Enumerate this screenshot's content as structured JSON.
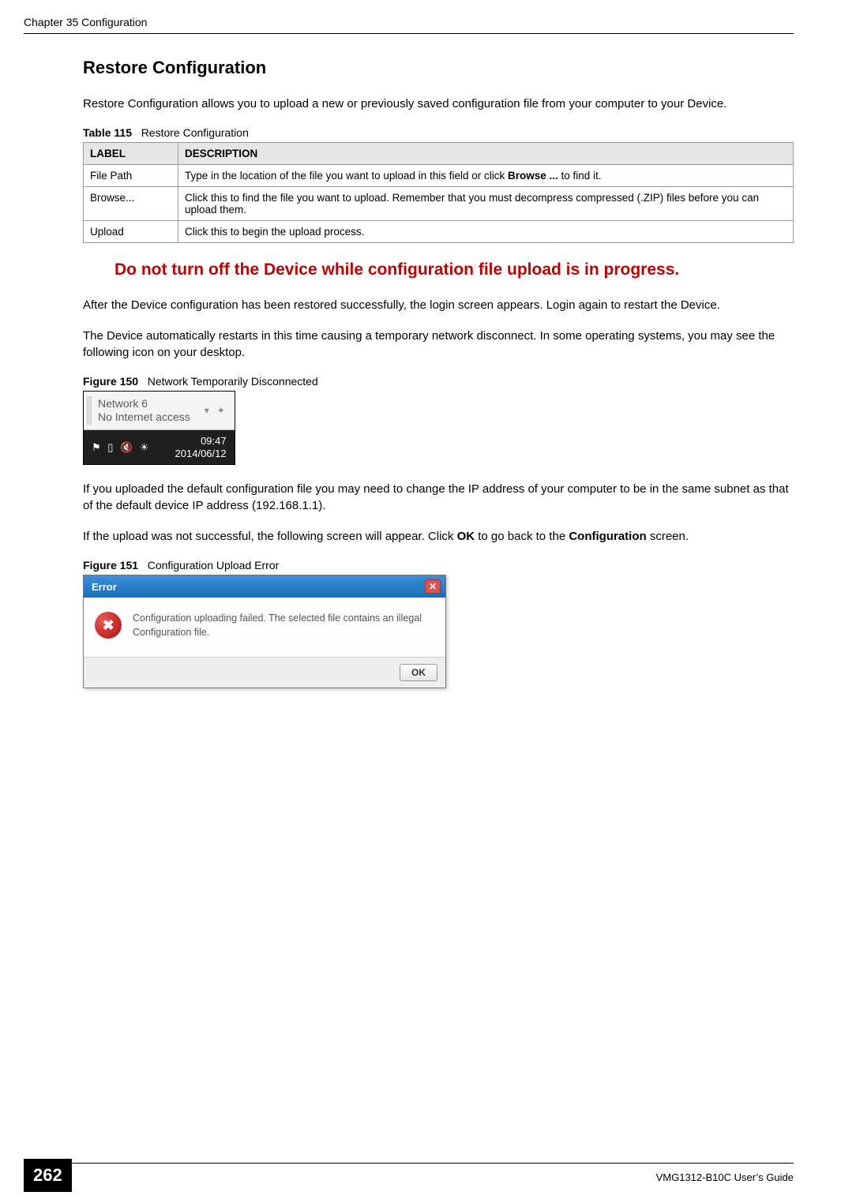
{
  "header": {
    "chapter": "Chapter 35 Configuration"
  },
  "section": {
    "title": "Restore Configuration",
    "intro": "Restore Configuration allows you to upload a new or previously saved configuration file from your computer to your Device."
  },
  "table115": {
    "caption_num": "Table 115",
    "caption_title": "Restore Configuration",
    "header_label": "LABEL",
    "header_desc": "DESCRIPTION",
    "rows": [
      {
        "label": "File Path",
        "desc_pre": "Type in the location of the file you want to upload in this field or click ",
        "desc_bold": "Browse ...",
        "desc_post": " to find it."
      },
      {
        "label": "Browse...",
        "desc_pre": "Click this to find the file you want to upload. Remember that you must decompress compressed (.ZIP) files before you can upload them.",
        "desc_bold": "",
        "desc_post": ""
      },
      {
        "label": "Upload",
        "desc_pre": "Click this to begin the upload process.",
        "desc_bold": "",
        "desc_post": ""
      }
    ]
  },
  "warning": "Do not turn off the Device while configuration file upload is in progress.",
  "para_after1": "After the Device configuration has been restored successfully, the login screen appears. Login again to restart the Device.",
  "para_after2": "The Device automatically restarts in this time causing a temporary network disconnect. In some operating systems, you may see the following icon on your desktop.",
  "fig150": {
    "caption_num": "Figure 150",
    "caption_title": "Network Temporarily Disconnected",
    "tooltip_line1": "Network 6",
    "tooltip_line2": "No Internet access",
    "ctrl_down": "▾",
    "ctrl_plus": "✦",
    "tray_time": "09:47",
    "tray_date": "2014/06/12",
    "ic_flag": "⚑",
    "ic_net": "▯",
    "ic_vol": "🔇",
    "ic_sun": "☀"
  },
  "para_after3": "If you uploaded the default configuration file you may need to change the IP address of your computer to be in the same subnet as that of the default device IP address (192.168.1.1).",
  "para_after4_pre": "If the upload was not successful, the following screen will appear. Click ",
  "para_after4_ok": "OK",
  "para_after4_mid": " to go back to the ",
  "para_after4_cfg": "Configuration",
  "para_after4_post": " screen.",
  "fig151": {
    "caption_num": "Figure 151",
    "caption_title": "Configuration Upload Error",
    "title": "Error",
    "close_glyph": "✕",
    "icon_glyph": "✖",
    "message": "Configuration uploading failed. The selected file contains an illegal Configuration file.",
    "ok_label": "OK"
  },
  "footer": {
    "page": "262",
    "guide": "VMG1312-B10C User’s Guide"
  }
}
